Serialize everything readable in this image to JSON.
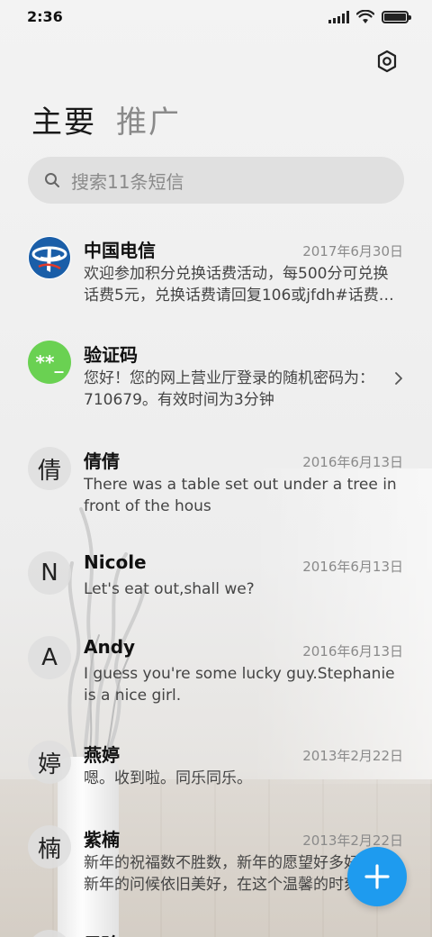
{
  "status": {
    "time": "2:36"
  },
  "tabs": [
    {
      "label": "主要",
      "active": true
    },
    {
      "label": "推广",
      "active": false
    }
  ],
  "search": {
    "placeholder": "搜索11条短信"
  },
  "conversations": [
    {
      "name": "中国电信",
      "date": "2017年6月30日",
      "preview": "欢迎参加积分兑换话费活动，每500分可兑换话费5元，兑换话费请回复106或jfdh#话费…",
      "avatar": "telecom-logo"
    },
    {
      "name": "验证码",
      "date": "",
      "preview": "您好！您的网上营业厅登录的随机密码为：710679。有效时间为3分钟",
      "avatar_text": "**_",
      "avatar_color": "#6ad152"
    },
    {
      "name": "倩倩",
      "date": "2016年6月13日",
      "preview": "There was a table set out under a tree in front of the hous",
      "avatar_text": "倩"
    },
    {
      "name": "Nicole",
      "date": "2016年6月13日",
      "preview": "Let's eat out,shall we?",
      "avatar_text": "N"
    },
    {
      "name": "Andy",
      "date": "2016年6月13日",
      "preview": "I guess you're some lucky guy.Stephanie is a nice girl.",
      "avatar_text": "A"
    },
    {
      "name": "燕婷",
      "date": "2013年2月22日",
      "preview": "嗯。收到啦。同乐同乐。",
      "avatar_text": "婷"
    },
    {
      "name": "紫楠",
      "date": "2013年2月22日",
      "preview": "新年的祝福数不胜数，新年的愿望好多好多，新年的问候依旧美好，在这个温馨的时刻…",
      "avatar_text": "楠"
    },
    {
      "name": "子玲",
      "date": "",
      "preview": "",
      "avatar_text": ""
    }
  ],
  "colors": {
    "accent": "#1e9bef",
    "telecom_blue": "#1a5ea8",
    "verify_green": "#6ad152"
  },
  "icons": {
    "settings": "settings-icon",
    "search": "search-icon",
    "compose": "plus-icon",
    "chevron": "chevron-right-icon"
  }
}
